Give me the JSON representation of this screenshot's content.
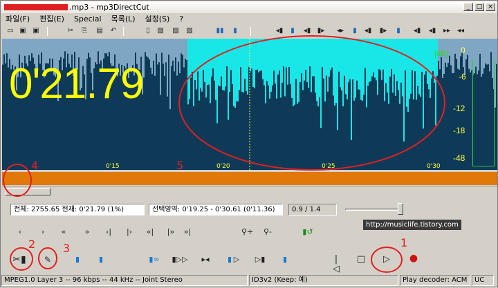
{
  "window": {
    "title": ".mp3 - mp3DirectCut",
    "controls": [
      "minimize-icon",
      "maximize-icon",
      "close-icon"
    ],
    "control_glyphs": [
      "_",
      "□",
      "×"
    ]
  },
  "menu": {
    "items": [
      "파일(F)",
      "편집(E)",
      "Special",
      "목록(L)",
      "설정(S)",
      "?"
    ]
  },
  "waveform": {
    "time_display": "0'21.79",
    "db_title": "[dB]",
    "db_scale": [
      "0",
      "-6",
      "-12",
      "-18",
      "-48"
    ],
    "time_ticks": [
      "0'15",
      "0'20",
      "0'25",
      "0'30"
    ],
    "colors": {
      "background": "#0e3a58",
      "selection": "#19e6e6",
      "wave": "#7fa7c4",
      "timecode": "#ffff00"
    }
  },
  "info": {
    "position_text": "전체: 2755.65  현재: 0'21.79  (1%)",
    "selection_text": "선택영역: 0'19.25 - 0'30.61 (0'11.36)",
    "ratio_text": "0.9 / 1.4"
  },
  "tooltip": "http://musiclife.tistory.com",
  "annotations": [
    "1",
    "2",
    "3",
    "4",
    "5"
  ],
  "statusbar": {
    "format": "MPEG1.0 Layer 3 -- 96 kbps -- 44 kHz -- Joint Stereo",
    "id3": "ID3v2 (Keep: 예)",
    "decoder": "Play decoder: ACM",
    "mode": "UC"
  }
}
